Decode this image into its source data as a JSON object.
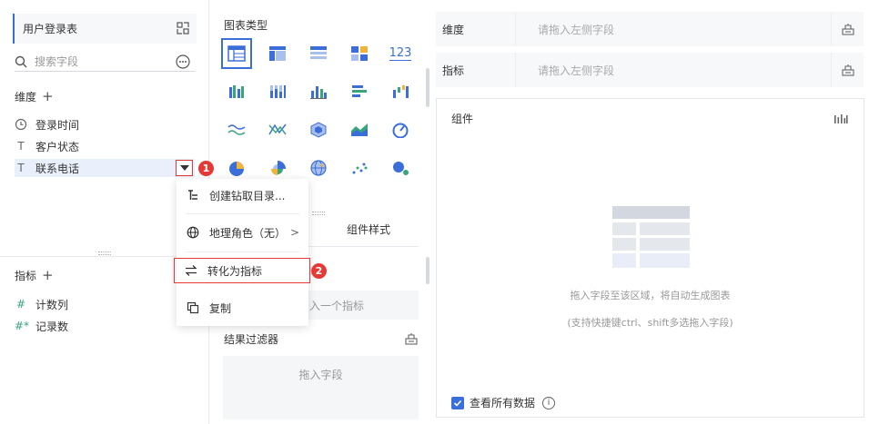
{
  "left_panel": {
    "table_name": "用户登录表",
    "search_placeholder": "搜索字段",
    "dimensions_title": "维度",
    "dimensions": [
      {
        "icon": "clock-icon",
        "label": "登录时间"
      },
      {
        "icon": "text-type-icon",
        "label": "客户状态"
      },
      {
        "icon": "text-type-icon",
        "label": "联系电话"
      }
    ],
    "metrics_title": "指标",
    "metrics": [
      {
        "icon": "hash-icon",
        "label": "计数列"
      },
      {
        "icon": "hash-formula-icon",
        "label": "记录数"
      }
    ]
  },
  "annotations": {
    "badge_1": "1",
    "badge_2": "2"
  },
  "context_menu": {
    "items": [
      {
        "icon": "drill-directory-icon",
        "label": "创建钻取目录..."
      },
      {
        "icon": "globe-icon",
        "label": "地理角色（无）",
        "has_submenu": true
      },
      {
        "icon": "swap-arrows-icon",
        "label": "转化为指标",
        "highlighted": true
      },
      {
        "icon": "copy-icon",
        "label": "复制"
      }
    ]
  },
  "middle_panel": {
    "chart_type_title": "图表类型",
    "chart_types": [
      "table-chart-icon",
      "crosstab-chart-icon",
      "detail-table-icon",
      "kpi-card-icon",
      "number-123-icon",
      "grouped-bar-icon",
      "stacked-bar-icon",
      "column-chart-icon",
      "horizontal-bar-icon",
      "waterfall-icon",
      "line-chart-icon",
      "multi-line-icon",
      "radar-icon",
      "area-chart-icon",
      "gauge-icon",
      "pie-chart-icon",
      "rose-chart-icon",
      "map-globe-icon",
      "scatter-icon",
      "bubble-icon"
    ],
    "number_icon_text": "123",
    "tab_component_style": "组件样式",
    "metric_drop_hint": "入一个指标",
    "filter_title": "结果过滤器",
    "filter_drop_hint": "拖入字段"
  },
  "right_panel": {
    "dimension_label": "维度",
    "dimension_placeholder": "请拖入左侧字段",
    "metric_label": "指标",
    "metric_placeholder": "请拖入左侧字段",
    "canvas_title": "组件",
    "hint_line1": "拖入字段至该区域，将自动生成图表",
    "hint_line2": "(支持快捷键ctrl、shift多选拖入字段)",
    "show_all_label": "查看所有数据"
  },
  "colors": {
    "accent": "#3b6ed8",
    "highlight_red": "#e53935"
  }
}
